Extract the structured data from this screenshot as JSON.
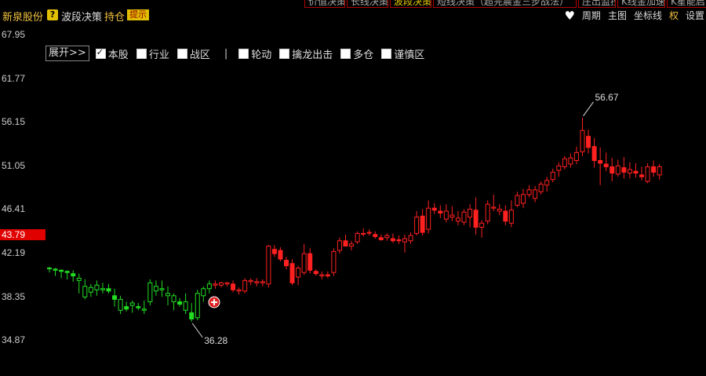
{
  "top_tabs": [
    {
      "label": "价值决策",
      "active": false
    },
    {
      "label": "长线决策",
      "active": false
    },
    {
      "label": "波段决策",
      "active": true
    },
    {
      "label": "短线决策（超完晨金三步战法）",
      "active": false
    },
    {
      "label": "庄出监控",
      "active": false
    },
    {
      "label": "K线金加速度",
      "active": false
    },
    {
      "label": "K星能启",
      "active": false
    }
  ],
  "title_bar": {
    "stock_name": "新泉股份",
    "help_icon": "?",
    "indicator": "波段决策",
    "position_label": "持仓",
    "tips_label": "提示"
  },
  "right_menu": {
    "period": "周期",
    "main_chart": "主图",
    "axis": "坐标线",
    "rights": "权",
    "settings": "设置"
  },
  "toolbar": {
    "expand_label": "展开>>",
    "separator": "|",
    "options": [
      {
        "label": "本股",
        "checked": true
      },
      {
        "label": "行业",
        "checked": false
      },
      {
        "label": "战区",
        "checked": false
      }
    ],
    "options2": [
      {
        "label": "轮动",
        "checked": false
      },
      {
        "label": "擒龙出击",
        "checked": false
      },
      {
        "label": "多仓",
        "checked": false
      },
      {
        "label": "谨慎区",
        "checked": false
      }
    ]
  },
  "current_price": "43.79",
  "chart_data": {
    "type": "candlestick",
    "y_ticks": [
      "67.95",
      "61.77",
      "56.15",
      "51.05",
      "46.41",
      "42.19",
      "38.35",
      "34.87"
    ],
    "y_tick_values": [
      67.95,
      61.77,
      56.15,
      51.05,
      46.41,
      42.19,
      38.35,
      34.87
    ],
    "ylim": [
      33.5,
      69.5
    ],
    "log_scale": true,
    "grid": false,
    "annotations": {
      "high": "56.67",
      "low": "36.28"
    },
    "up_color": "#ff2020",
    "down_color": "#ff2020",
    "green_color": "#22dd22",
    "candles": [
      [
        40.8,
        40.9,
        40.4,
        40.8,
        "g"
      ],
      [
        40.7,
        40.8,
        40.1,
        40.6,
        "g"
      ],
      [
        40.6,
        40.7,
        39.9,
        40.5,
        "g"
      ],
      [
        40.5,
        40.6,
        39.8,
        40.4,
        "g"
      ],
      [
        40.3,
        40.6,
        39.6,
        40.1,
        "g"
      ],
      [
        39.7,
        40.3,
        38.6,
        39.9,
        "g"
      ],
      [
        38.3,
        39.8,
        38.1,
        39.2,
        "g"
      ],
      [
        38.7,
        39.4,
        38.3,
        39.1,
        "g"
      ],
      [
        38.9,
        39.7,
        38.4,
        39.3,
        "g"
      ],
      [
        38.9,
        39.5,
        38.6,
        39.0,
        "g"
      ],
      [
        39.0,
        39.4,
        38.6,
        38.8,
        "g"
      ],
      [
        38.4,
        39.0,
        37.5,
        38.1,
        "g"
      ],
      [
        37.2,
        38.4,
        36.9,
        38.1,
        "g"
      ],
      [
        37.5,
        37.9,
        37.1,
        37.3,
        "g"
      ],
      [
        37.6,
        38.0,
        37.0,
        37.8,
        "g"
      ],
      [
        37.5,
        37.8,
        37.2,
        37.4,
        "g"
      ],
      [
        37.2,
        38.0,
        36.9,
        37.3,
        "g"
      ],
      [
        37.9,
        39.8,
        37.6,
        39.5,
        "g"
      ],
      [
        38.8,
        39.7,
        38.4,
        39.2,
        "g"
      ],
      [
        38.9,
        39.7,
        38.3,
        39.0,
        "g"
      ],
      [
        38.4,
        39.2,
        37.6,
        38.6,
        "g"
      ],
      [
        37.9,
        38.6,
        37.2,
        38.4,
        "g"
      ],
      [
        37.9,
        38.2,
        37.5,
        37.7,
        "g"
      ],
      [
        37.2,
        38.6,
        36.9,
        37.9,
        "g"
      ],
      [
        37.0,
        37.8,
        36.28,
        36.5,
        "g"
      ],
      [
        36.6,
        38.9,
        36.4,
        38.6,
        "g"
      ],
      [
        38.4,
        39.2,
        37.9,
        39.0,
        "g"
      ],
      [
        39.0,
        39.7,
        38.6,
        39.4,
        "g"
      ],
      [
        39.3,
        39.7,
        39.0,
        39.4,
        "r"
      ],
      [
        39.3,
        39.6,
        39.1,
        39.5,
        "r"
      ],
      [
        39.4,
        39.6,
        39.2,
        39.5,
        "r"
      ],
      [
        39.4,
        39.7,
        38.7,
        38.9,
        "r"
      ],
      [
        38.8,
        39.1,
        38.5,
        38.9,
        "r"
      ],
      [
        38.8,
        39.9,
        38.6,
        39.7,
        "r"
      ],
      [
        39.6,
        39.9,
        39.3,
        39.7,
        "r"
      ],
      [
        39.5,
        39.9,
        39.2,
        39.6,
        "r"
      ],
      [
        39.5,
        39.8,
        39.2,
        39.6,
        "r"
      ],
      [
        39.4,
        42.9,
        39.1,
        42.8,
        "r"
      ],
      [
        42.5,
        42.9,
        41.8,
        42.1,
        "r"
      ],
      [
        42.4,
        42.7,
        41.4,
        41.6,
        "r"
      ],
      [
        41.5,
        41.8,
        40.7,
        41.0,
        "r"
      ],
      [
        41.2,
        41.6,
        39.3,
        39.5,
        "r"
      ],
      [
        40.0,
        41.0,
        39.3,
        40.8,
        "r"
      ],
      [
        40.4,
        43.0,
        40.2,
        42.1,
        "r"
      ],
      [
        42.1,
        42.6,
        40.3,
        40.6,
        "r"
      ],
      [
        40.5,
        40.7,
        40.1,
        40.3,
        "r"
      ],
      [
        40.1,
        40.5,
        39.8,
        40.2,
        "r"
      ],
      [
        40.2,
        40.5,
        39.9,
        40.1,
        "r"
      ],
      [
        40.4,
        42.6,
        40.1,
        42.3,
        "r"
      ],
      [
        42.4,
        43.6,
        42.1,
        43.3,
        "r"
      ],
      [
        43.3,
        43.9,
        42.8,
        42.8,
        "r"
      ],
      [
        42.8,
        43.3,
        42.4,
        43.0,
        "r"
      ],
      [
        43.2,
        44.2,
        43.0,
        44.0,
        "r"
      ],
      [
        44.0,
        44.5,
        43.7,
        44.0,
        "r"
      ],
      [
        44.1,
        44.4,
        43.8,
        44.1,
        "r"
      ],
      [
        43.9,
        44.2,
        43.5,
        43.7,
        "r"
      ],
      [
        43.6,
        43.9,
        43.3,
        43.4,
        "r"
      ],
      [
        43.6,
        44.0,
        43.3,
        43.8,
        "r"
      ],
      [
        43.5,
        44.0,
        43.1,
        43.3,
        "r"
      ],
      [
        43.4,
        43.8,
        43.0,
        43.3,
        "r"
      ],
      [
        43.2,
        43.9,
        42.2,
        43.5,
        "r"
      ],
      [
        43.3,
        44.1,
        43.0,
        43.8,
        "r"
      ],
      [
        44.0,
        46.2,
        43.8,
        45.6,
        "r"
      ],
      [
        45.7,
        46.4,
        43.8,
        44.1,
        "r"
      ],
      [
        44.4,
        47.3,
        44.0,
        46.5,
        "r"
      ],
      [
        46.5,
        47.0,
        45.9,
        46.3,
        "r"
      ],
      [
        46.2,
        46.8,
        45.5,
        46.0,
        "r"
      ],
      [
        45.4,
        46.9,
        45.1,
        46.2,
        "r"
      ],
      [
        45.6,
        46.7,
        45.2,
        45.8,
        "r"
      ],
      [
        45.2,
        46.2,
        44.8,
        45.5,
        "r"
      ],
      [
        45.1,
        46.4,
        44.8,
        46.1,
        "r"
      ],
      [
        45.6,
        46.9,
        44.6,
        46.4,
        "r"
      ],
      [
        46.3,
        47.6,
        43.9,
        44.6,
        "r"
      ],
      [
        44.6,
        45.3,
        43.6,
        45.0,
        "r"
      ],
      [
        45.2,
        47.3,
        44.9,
        46.9,
        "r"
      ],
      [
        46.5,
        47.9,
        46.2,
        46.6,
        "r"
      ],
      [
        46.2,
        46.9,
        45.8,
        46.4,
        "r"
      ],
      [
        46.2,
        46.8,
        44.8,
        45.2,
        "r"
      ],
      [
        45.0,
        47.3,
        44.6,
        46.3,
        "r"
      ],
      [
        46.8,
        48.2,
        46.6,
        47.8,
        "r"
      ],
      [
        47.0,
        48.5,
        46.5,
        47.9,
        "r"
      ],
      [
        47.9,
        48.9,
        47.6,
        48.4,
        "r"
      ],
      [
        47.5,
        48.8,
        47.1,
        48.4,
        "r"
      ],
      [
        48.2,
        49.3,
        47.9,
        49.0,
        "r"
      ],
      [
        48.9,
        49.8,
        48.2,
        49.4,
        "r"
      ],
      [
        49.5,
        50.7,
        49.2,
        50.3,
        "r"
      ],
      [
        50.5,
        51.4,
        49.8,
        51.0,
        "r"
      ],
      [
        50.9,
        52.1,
        50.6,
        51.8,
        "r"
      ],
      [
        51.2,
        52.4,
        50.8,
        51.9,
        "r"
      ],
      [
        51.6,
        53.2,
        51.2,
        52.5,
        "r"
      ],
      [
        52.6,
        56.67,
        52.1,
        55.1,
        "r"
      ],
      [
        54.4,
        55.2,
        52.4,
        53.1,
        "r"
      ],
      [
        53.2,
        54.2,
        50.8,
        51.6,
        "r"
      ],
      [
        51.6,
        53.1,
        48.9,
        51.3,
        "r"
      ],
      [
        51.2,
        52.5,
        50.4,
        50.9,
        "r"
      ],
      [
        50.9,
        51.9,
        49.3,
        50.2,
        "r"
      ],
      [
        50.1,
        51.7,
        49.8,
        51.0,
        "r"
      ],
      [
        50.8,
        52.0,
        49.6,
        50.3,
        "r"
      ],
      [
        50.2,
        51.4,
        49.6,
        50.6,
        "r"
      ],
      [
        50.4,
        51.3,
        49.7,
        50.2,
        "r"
      ],
      [
        50.0,
        50.9,
        49.4,
        49.8,
        "r"
      ],
      [
        49.3,
        51.3,
        49.1,
        50.9,
        "r"
      ],
      [
        50.9,
        51.6,
        49.8,
        50.3,
        "r"
      ],
      [
        50.0,
        51.2,
        49.5,
        50.9,
        "r"
      ]
    ]
  }
}
